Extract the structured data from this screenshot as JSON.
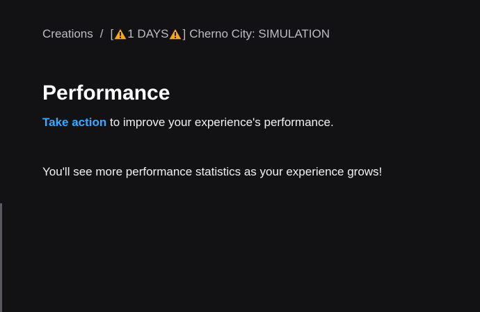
{
  "breadcrumb": {
    "root": "Creations",
    "separator": "/",
    "current_open_bracket": "[",
    "current_badge": "1 DAYS",
    "current_close_bracket": "]",
    "current_title": "Cherno City: SIMULATION"
  },
  "page": {
    "title": "Performance",
    "action_link": "Take action",
    "action_rest": " to improve your experience's performance.",
    "info": "You'll see more performance statistics as your experience grows!"
  },
  "icons": {
    "warning": "warning-icon"
  },
  "colors": {
    "background": "#121215",
    "link": "#3aa9ff",
    "warning": "#f5a623",
    "muted_text": "#bdbdc2",
    "text": "#f2f2f2"
  }
}
